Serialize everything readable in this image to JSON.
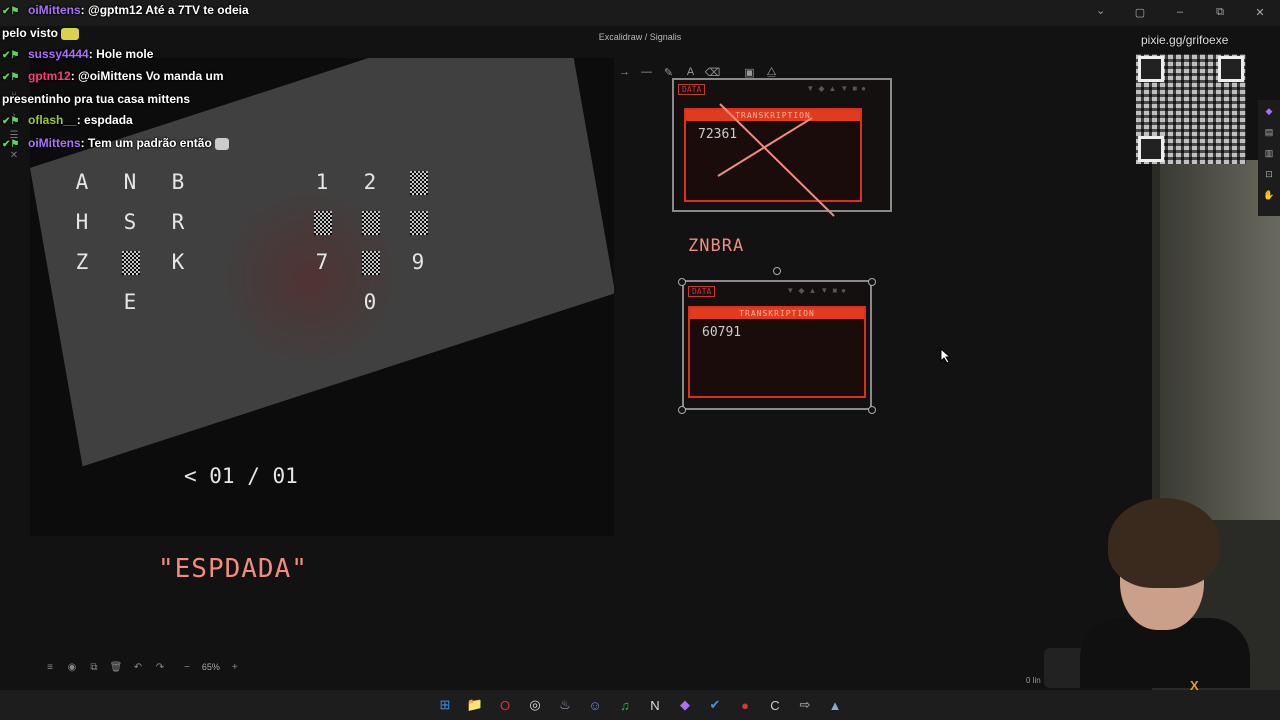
{
  "window": {
    "breadcrumb": "Excalidraw / Signalis",
    "controls": [
      "chevron",
      "panel",
      "minimize",
      "maximize",
      "close"
    ]
  },
  "chat": [
    {
      "name": "oiMittens",
      "message": "@gptm12 Até a 7TV te odeia pelo visto",
      "name_color": "#a970ff"
    },
    {
      "name": "sussy4444",
      "message": "Hole mole",
      "name_color": "#a970ff"
    },
    {
      "name": "gptm12",
      "message": "@oiMittens Vo manda um presentinho pra tua casa mittens",
      "name_color": "#ff3b80"
    },
    {
      "name": "oflash__",
      "message": "espdada",
      "name_color": "#9acd32"
    },
    {
      "name": "oiMittens",
      "message": "Tem um padrão então",
      "name_color": "#a970ff"
    }
  ],
  "toolbar": {
    "tools": [
      "selection-icon",
      "rectangle-icon",
      "diamond-icon",
      "ellipse-icon",
      "arrow-icon",
      "line-icon",
      "pencil-icon",
      "text-icon",
      "eraser-icon",
      "image-icon",
      "shapes-icon"
    ],
    "glyphs": [
      "➤",
      "□",
      "◇",
      "○",
      "→",
      "—",
      "✎",
      "A",
      "⌫",
      "▣",
      "⧋"
    ],
    "active": 0
  },
  "game": {
    "letters": [
      {
        "ch": "A"
      },
      {
        "ch": "N"
      },
      {
        "ch": "B"
      },
      {
        "ch": "H"
      },
      {
        "ch": "S"
      },
      {
        "ch": "R"
      },
      {
        "ch": "Z"
      },
      {
        "ch": "K"
      },
      {
        "ch": "E"
      }
    ],
    "digits": [
      {
        "ch": "1"
      },
      {
        "ch": "2"
      },
      {
        "ch": "7"
      },
      {
        "ch": "9"
      },
      {
        "ch": "0"
      }
    ],
    "pager": "< 01 / 01"
  },
  "notes": {
    "quote": "\"ESPDADA\"",
    "word": "ZNBRA"
  },
  "panels": [
    {
      "header": "DATA",
      "bar": "TRANSKRIPTION",
      "code": "72361",
      "crossed": true
    },
    {
      "header": "DATA",
      "bar": "TRANSKRIPTION",
      "code": "60791",
      "crossed": false
    }
  ],
  "overlay": {
    "pixie": "pixie.gg/grifoexe"
  },
  "bottom": {
    "zoom": "65%",
    "lines": "0 lin"
  },
  "taskbar": [
    "windows-icon",
    "folder-icon",
    "opera-icon",
    "chrome-icon",
    "steam-icon",
    "discord-icon",
    "spotify-icon",
    "notion-icon",
    "obsidian-icon",
    "todo-icon",
    "record-icon",
    "cursor-app-icon",
    "arrow-app-icon",
    "excalidraw-app-icon"
  ],
  "colors": {
    "accent": "#2b64d6",
    "annotation": "#f28b82",
    "transcription_red": "#e23a1e"
  }
}
